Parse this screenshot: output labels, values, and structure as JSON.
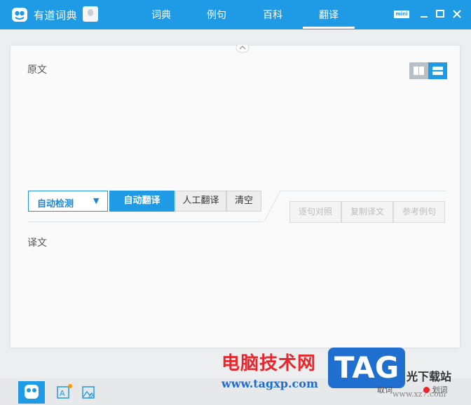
{
  "app": {
    "title": "有道词典"
  },
  "nav": {
    "tabs": [
      {
        "label": "词典"
      },
      {
        "label": "例句"
      },
      {
        "label": "百科"
      },
      {
        "label": "翻译"
      }
    ],
    "active_tab": "翻译"
  },
  "window_controls": {
    "mini_label": "mini"
  },
  "source": {
    "label": "原文",
    "text": ""
  },
  "toolbar": {
    "language_select": "自动检测",
    "auto_translate": "自动翻译",
    "human_translate": "人工翻译",
    "clear": "清空",
    "compare_sentences": "逐句对照",
    "copy_translation": "复制译文",
    "reference_examples": "参考例句"
  },
  "target": {
    "label": "译文",
    "text": ""
  },
  "watermark": {
    "site_name": "电脑技术网",
    "url": "www.tagxp.com",
    "badge": "TAG",
    "right_text": "光下载站",
    "right_url": "www.xz7.com",
    "bottom_labels": [
      "取词",
      "划词"
    ]
  },
  "colors": {
    "brand_blue": "#1e9be4",
    "watermark_red": "#e8262b",
    "watermark_blue": "#1e6fd0"
  }
}
